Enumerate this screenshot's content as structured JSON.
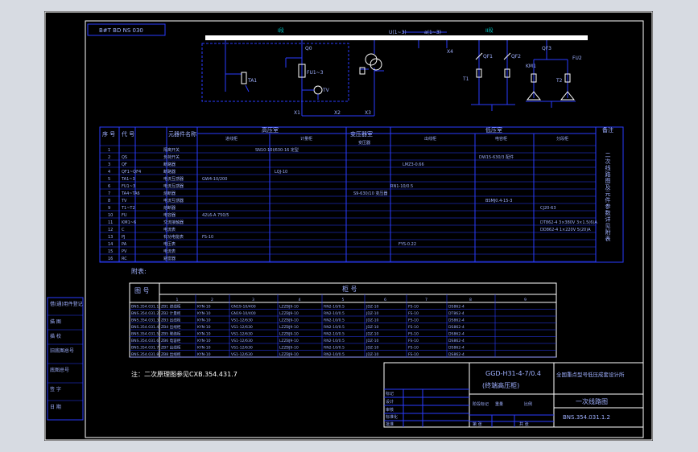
{
  "code_box": "B#T BD NS 030",
  "hv_part": {
    "section_1": "I段",
    "section_2": "II段",
    "label_qs0": "Q0",
    "label_ta1": "TA1",
    "label_fu": "FU1~3",
    "label_pt": "TV",
    "label_bus_u": "U(1~3)",
    "label_bus_a": "a(1~3)",
    "label_x1": "X1",
    "label_x2": "X2",
    "label_x3": "X3",
    "label_x4": "X4",
    "label_q1": "QF1",
    "label_q2": "QF2",
    "label_q3": "QF3",
    "label_km": "KM1",
    "label_fu2": "FU2",
    "label_t1": "T1",
    "label_t2": "T2"
  },
  "main_table": {
    "headers": [
      "序 号",
      "代 号",
      "元器件名称",
      "高压室",
      "变压器室",
      "低压室",
      "备注"
    ],
    "subheaders": [
      "进线柜",
      "计量柜",
      "变压器",
      "出线柜",
      "电容柜",
      "分段柜"
    ],
    "row_numbers": [
      "1",
      "2",
      "3",
      "4",
      "5",
      "6",
      "7",
      "8",
      "9",
      "10",
      "11",
      "12",
      "13",
      "14",
      "15",
      "16"
    ],
    "codes": [
      "",
      "QS",
      "QF",
      "QF1~QF4",
      "TA1~3",
      "FU1~3",
      "TA4~TA6",
      "TV",
      "T1~T2",
      "FU",
      "KM1~6",
      "C",
      "PJ",
      "PA",
      "PV",
      "RC"
    ],
    "names": [
      "隔离开关",
      "负荷开关",
      "断路器",
      "断路器",
      "电流互感器",
      "电流互感器",
      "熔断器",
      "电流互感器",
      "熔断器",
      "电容器",
      "交流接触器",
      "电流表",
      "有功电能表",
      "电压表",
      "电流表",
      "避雷器"
    ],
    "notes": [
      "SN10-10I/630-16 定型",
      "DW15-630/3 配件",
      "LMZ3-0.66",
      "LQJ-10",
      "GW4-10/200",
      "RN1-10/0.5",
      "S9-630/10 变压器",
      "BSMJ0.4-15-3",
      "CJ20-63",
      "42L6-A 750/5",
      "DT862-4 3×380V 3×1.5(6)A",
      "DD862-4 1×220V 5(20)A",
      "FS-10",
      "FYS-0.22"
    ],
    "remark": "二次线路图及元件参数详见附表"
  },
  "sub_table": {
    "caption": "附表:",
    "header_a": "图 号",
    "header_b": "柜 号",
    "columns": [
      "1",
      "2",
      "3",
      "4",
      "5",
      "6",
      "7",
      "8",
      "9"
    ],
    "rows": [
      [
        "BNS.354.031.1",
        "ZB1 进线柜",
        "KYN-10",
        "GN19-10/400",
        "LZZBJ9-10",
        "RN2-10/0.5",
        "JDZ-10",
        "FS-10",
        "DS862-4"
      ],
      [
        "BNS.354.031.2",
        "ZB2 计量柜",
        "KYN-10",
        "GN19-10/400",
        "LZZBJ9-10",
        "RN2-10/0.5",
        "JDZ-10",
        "FS-10",
        "DT862-4"
      ],
      [
        "BNS.354.031.3",
        "ZB3 出线柜",
        "KYN-10",
        "VS1-12/630",
        "LZZBJ9-10",
        "RN2-10/0.5",
        "JDZ-10",
        "FS-10",
        "DS862-4"
      ],
      [
        "BNS.354.031.4",
        "ZB4 出线柜",
        "KYN-10",
        "VS1-12/630",
        "LZZBJ9-10",
        "RN2-10/0.5",
        "JDZ-10",
        "FS-10",
        "DS862-4"
      ],
      [
        "BNS.354.031.5",
        "ZB5 联络柜",
        "KYN-10",
        "VS1-12/630",
        "LZZBJ9-10",
        "RN2-10/0.5",
        "JDZ-10",
        "FS-10",
        "DS862-4"
      ],
      [
        "BNS.354.031.6",
        "ZB6 电容柜",
        "KYN-10",
        "VS1-12/630",
        "LZZBJ9-10",
        "RN2-10/0.5",
        "JDZ-10",
        "FS-10",
        "DS862-4"
      ],
      [
        "BNS.354.031.7",
        "ZB7 出线柜",
        "KYN-10",
        "VS1-12/630",
        "LZZBJ9-10",
        "RN2-10/0.5",
        "JDZ-10",
        "FS-10",
        "DS862-4"
      ],
      [
        "BNS.354.031.8",
        "ZB8 出线柜",
        "KYN-10",
        "VS1-12/630",
        "LZZBJ9-10",
        "RN2-10/0.5",
        "JDZ-10",
        "FS-10",
        "DS862-4"
      ]
    ]
  },
  "footnote": "注：二次原理图参见CXB.354.431.7",
  "left_stamp": [
    "借(通)用件登记",
    "描 图",
    "描 校",
    "旧底图总号",
    "底图总号",
    "签 字",
    "日 期"
  ],
  "title_block": {
    "model": "GGD-H31-4-7/0.4",
    "model_sub": "(终端高压柜)",
    "company": "全国重点型号低压成套设计所",
    "drawing_name": "一次线路图",
    "drawing_no": "BNS.354.031.1.2",
    "label_design": "设计",
    "label_check": "审核",
    "label_standard": "标准化",
    "label_approve": "批准",
    "label_mark": "标记",
    "label_scale": "比例",
    "label_weight": "重量",
    "label_sheet": "第 张",
    "label_total": "共 张",
    "label_stage": "阶段标记"
  },
  "colors": {
    "background": "#000000",
    "frame": "#ffffff",
    "lines": "#2a3cff",
    "text": "#9fb0ff",
    "accent_cyan": "#00d0d0",
    "accent_yellow": "#e8e070",
    "page": "#d7dbe2"
  }
}
